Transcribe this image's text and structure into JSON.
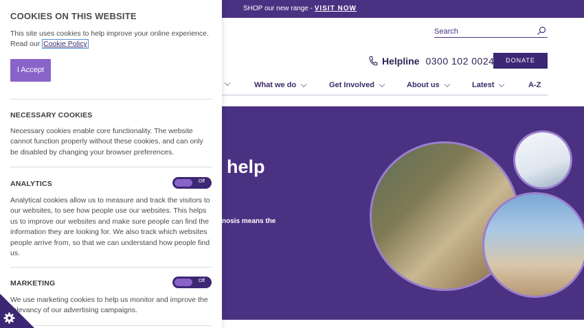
{
  "banner": {
    "text": "SHOP our new range - ",
    "link": "VISIT NOW"
  },
  "header": {
    "search_placeholder": "Search",
    "helpline_label": "Helpline",
    "helpline_number": "0300 102 0024",
    "donate_label": "DONATE"
  },
  "nav": {
    "items": [
      "What we do",
      "Get Involved",
      "About us",
      "Latest",
      "A-Z"
    ]
  },
  "hero": {
    "title_fragment": "help",
    "sub_fragment": "nosis means the"
  },
  "cookies": {
    "title": "COOKIES ON THIS WEBSITE",
    "intro": "This site uses cookies to help improve your online experience. Read our ",
    "policy_link": "Cookie Policy",
    "accept_label": "I Accept",
    "sections": [
      {
        "heading": "NECESSARY COOKIES",
        "text": "Necessary cookies enable core functionality. The website cannot function properly without these cookies, and can only be disabled by changing your browser preferences."
      },
      {
        "heading": "ANALYTICS",
        "toggle": "Off",
        "text": "Analytical cookies allow us to measure and track the visitors to our websites, to see how people use our websites. This helps us to improve our websites and make sure people can find the information they are looking for. We also track which websites people arrive from, so that we can understand how people find us."
      },
      {
        "heading": "MARKETING",
        "toggle": "Off",
        "text": "We use marketing cookies to help us monitor and improve the relevancy of our advertising campaigns."
      }
    ]
  },
  "colors": {
    "brand_purple": "#4b3182",
    "dark_purple": "#3b2773",
    "accent_purple": "#8a63c9"
  },
  "icons": {
    "search": "search-icon",
    "phone": "phone-icon",
    "settings": "gear-icon"
  }
}
